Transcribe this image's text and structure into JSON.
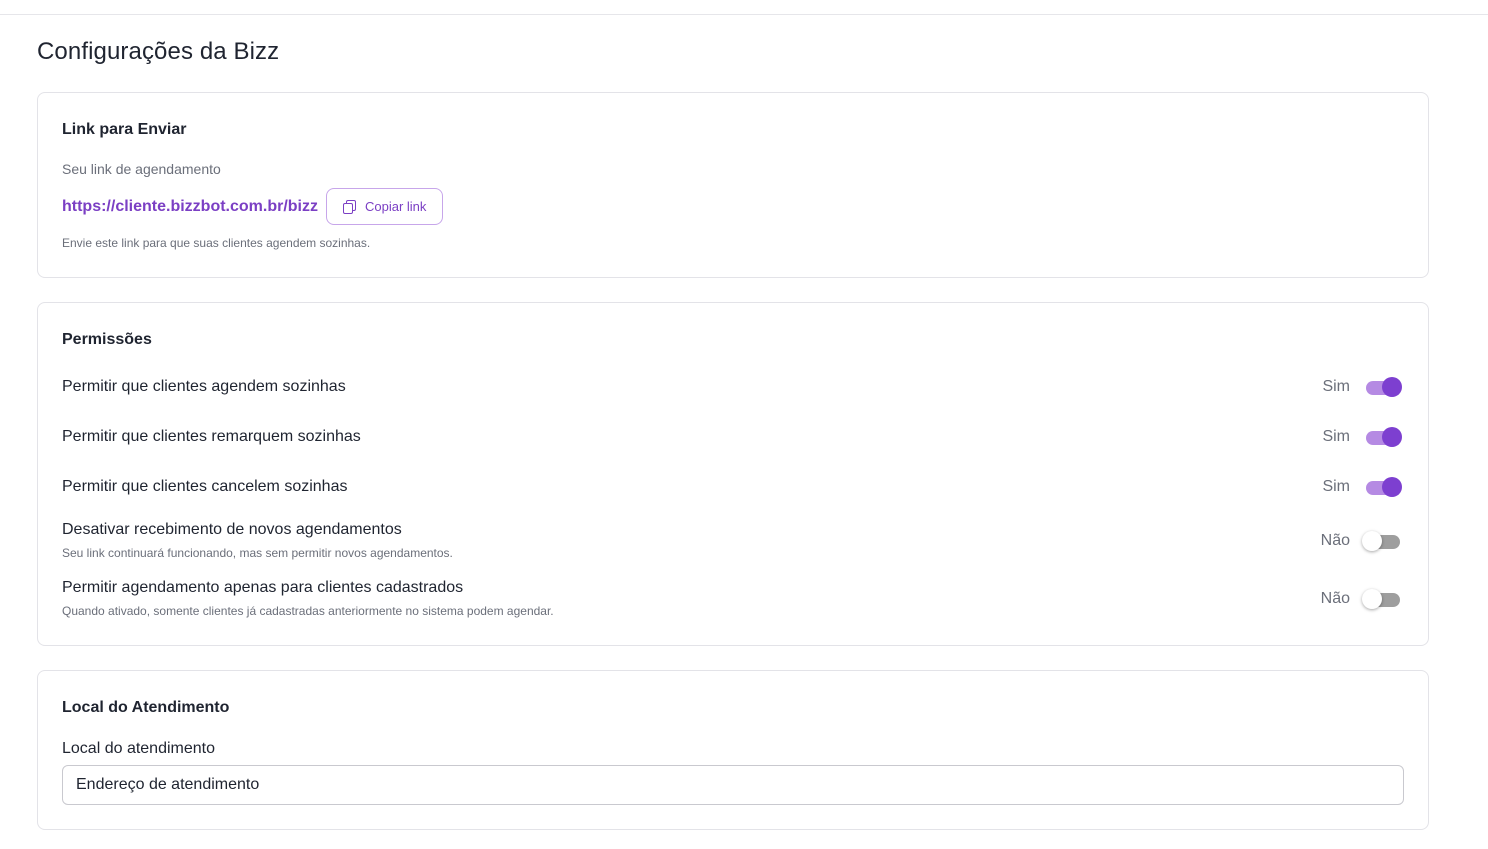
{
  "page": {
    "title": "Configurações da Bizz"
  },
  "link_card": {
    "title": "Link para Enviar",
    "subtitle": "Seu link de agendamento",
    "url": "https://cliente.bizzbot.com.br/bizz",
    "copy_label": "Copiar link",
    "hint": "Envie este link para que suas clientes agendem sozinhas."
  },
  "permissions": {
    "title": "Permissões",
    "items": [
      {
        "label": "Permitir que clientes agendem sozinhas",
        "description": "",
        "status": "Sim",
        "enabled": true
      },
      {
        "label": "Permitir que clientes remarquem sozinhas",
        "description": "",
        "status": "Sim",
        "enabled": true
      },
      {
        "label": "Permitir que clientes cancelem sozinhas",
        "description": "",
        "status": "Sim",
        "enabled": true
      },
      {
        "label": "Desativar recebimento de novos agendamentos",
        "description": "Seu link continuará funcionando, mas sem permitir novos agendamentos.",
        "status": "Não",
        "enabled": false
      },
      {
        "label": "Permitir agendamento apenas para clientes cadastrados",
        "description": "Quando ativado, somente clientes já cadastradas anteriormente no sistema podem agendar.",
        "status": "Não",
        "enabled": false
      }
    ]
  },
  "location": {
    "title": "Local do Atendimento",
    "field_label": "Local do atendimento",
    "input_value": "Endereço de atendimento"
  },
  "colors": {
    "accent": "#7d3fd0",
    "accent_light": "#b58ae3",
    "link": "#7b3fc4",
    "muted": "#6b6f7a"
  },
  "icons": {
    "copy": "copy-icon"
  }
}
